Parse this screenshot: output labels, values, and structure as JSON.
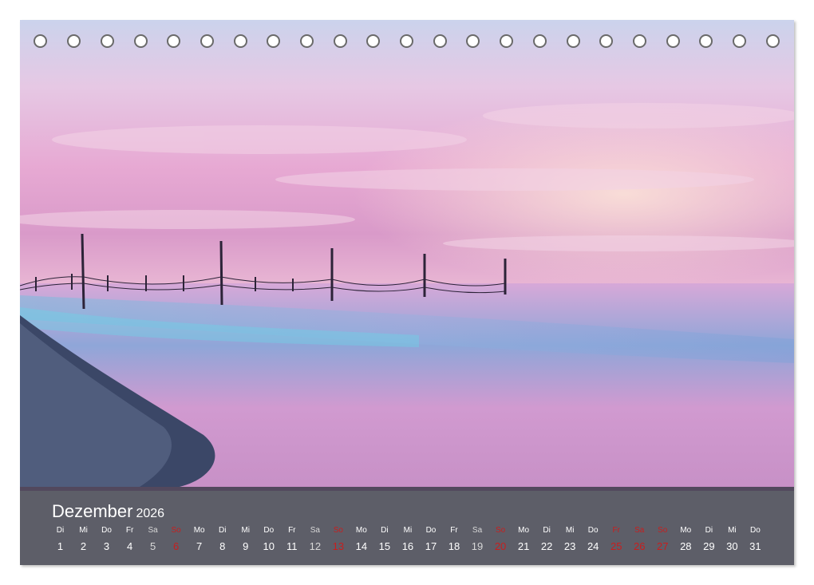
{
  "calendar": {
    "month": "Dezember",
    "year": "2026",
    "days": [
      {
        "name": "Di",
        "num": "1",
        "kind": "wd"
      },
      {
        "name": "Mi",
        "num": "2",
        "kind": "wd"
      },
      {
        "name": "Do",
        "num": "3",
        "kind": "wd"
      },
      {
        "name": "Fr",
        "num": "4",
        "kind": "wd"
      },
      {
        "name": "Sa",
        "num": "5",
        "kind": "sat"
      },
      {
        "name": "So",
        "num": "6",
        "kind": "we"
      },
      {
        "name": "Mo",
        "num": "7",
        "kind": "wd"
      },
      {
        "name": "Di",
        "num": "8",
        "kind": "wd"
      },
      {
        "name": "Mi",
        "num": "9",
        "kind": "wd"
      },
      {
        "name": "Do",
        "num": "10",
        "kind": "wd"
      },
      {
        "name": "Fr",
        "num": "11",
        "kind": "wd"
      },
      {
        "name": "Sa",
        "num": "12",
        "kind": "sat"
      },
      {
        "name": "So",
        "num": "13",
        "kind": "we"
      },
      {
        "name": "Mo",
        "num": "14",
        "kind": "wd"
      },
      {
        "name": "Di",
        "num": "15",
        "kind": "wd"
      },
      {
        "name": "Mi",
        "num": "16",
        "kind": "wd"
      },
      {
        "name": "Do",
        "num": "17",
        "kind": "wd"
      },
      {
        "name": "Fr",
        "num": "18",
        "kind": "wd"
      },
      {
        "name": "Sa",
        "num": "19",
        "kind": "sat"
      },
      {
        "name": "So",
        "num": "20",
        "kind": "we"
      },
      {
        "name": "Mo",
        "num": "21",
        "kind": "wd"
      },
      {
        "name": "Di",
        "num": "22",
        "kind": "wd"
      },
      {
        "name": "Mi",
        "num": "23",
        "kind": "wd"
      },
      {
        "name": "Do",
        "num": "24",
        "kind": "wd"
      },
      {
        "name": "Fr",
        "num": "25",
        "kind": "hol"
      },
      {
        "name": "Sa",
        "num": "26",
        "kind": "hol"
      },
      {
        "name": "So",
        "num": "27",
        "kind": "we"
      },
      {
        "name": "Mo",
        "num": "28",
        "kind": "wd"
      },
      {
        "name": "Di",
        "num": "29",
        "kind": "wd"
      },
      {
        "name": "Mi",
        "num": "30",
        "kind": "wd"
      },
      {
        "name": "Do",
        "num": "31",
        "kind": "wd"
      }
    ]
  },
  "colors": {
    "holiday": "#c81e1e",
    "bar": "#343642"
  }
}
